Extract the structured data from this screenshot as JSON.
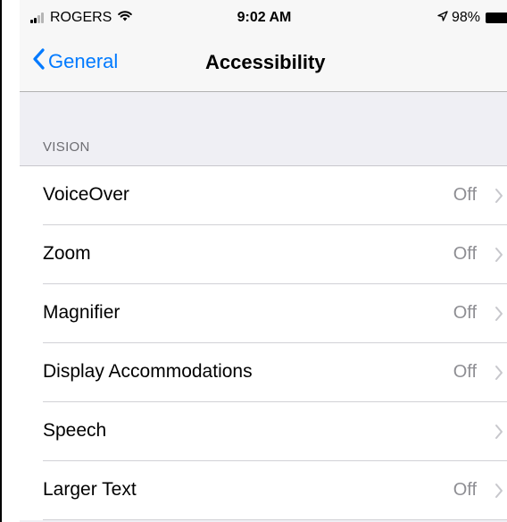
{
  "status_bar": {
    "carrier": "ROGERS",
    "time": "9:02 AM",
    "battery": "98%",
    "icons": [
      "signal-icon",
      "wifi-icon",
      "location-arrow-icon",
      "battery-icon"
    ]
  },
  "nav": {
    "back_label": "General",
    "title": "Accessibility"
  },
  "section": {
    "header": "VISION"
  },
  "rows": [
    {
      "label": "VoiceOver",
      "value": "Off"
    },
    {
      "label": "Zoom",
      "value": "Off"
    },
    {
      "label": "Magnifier",
      "value": "Off"
    },
    {
      "label": "Display Accommodations",
      "value": "Off"
    },
    {
      "label": "Speech",
      "value": ""
    },
    {
      "label": "Larger Text",
      "value": "Off"
    }
  ],
  "colors": {
    "accent": "#007aff",
    "secondary_text": "#8e8e93",
    "group_background": "#efeff4",
    "chevron": "#c7c7cc"
  }
}
